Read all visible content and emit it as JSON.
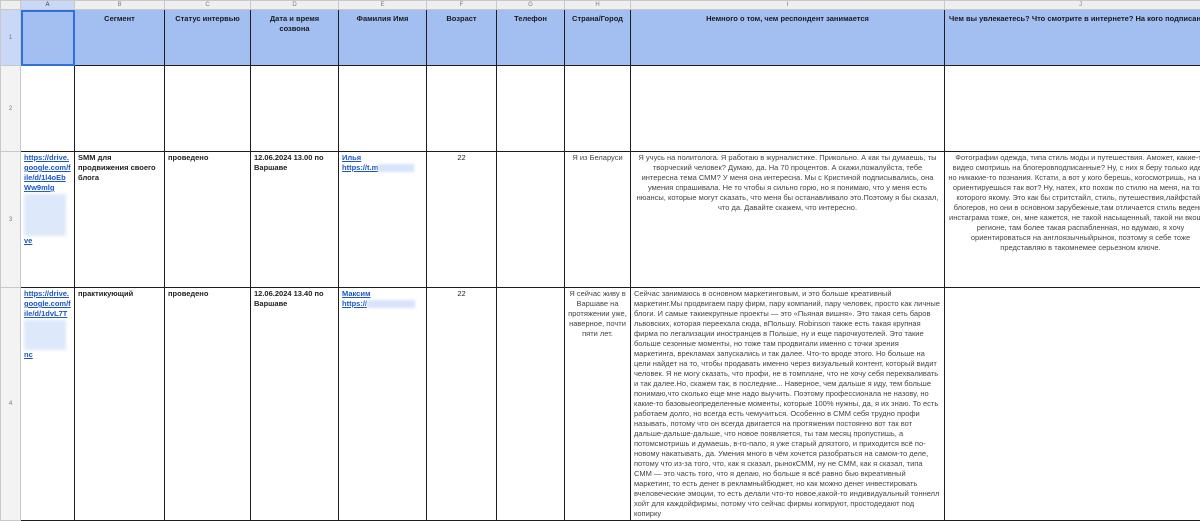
{
  "column_letters": [
    "A",
    "B",
    "C",
    "D",
    "E",
    "F",
    "G",
    "H",
    "I",
    "J"
  ],
  "row_numbers": [
    "1",
    "2",
    "3",
    "4"
  ],
  "headers": {
    "a": "",
    "b": "Сегмент",
    "c": "Статус интервью",
    "d": "Дата и время созвона",
    "e": "Фамилия Имя",
    "f": "Возраст",
    "g": "Телефон",
    "h": "Страна/Город",
    "i": "Немного о том, чем респондент занимается",
    "j": "Чем вы увлекаетесь? Что смотрите в интернете? На кого подписаны?"
  },
  "rows": [
    {
      "link": "https://drive.google.com/file/d/1l4oEb Ww9mlg",
      "link_tail": "ve",
      "segment": "SMM для продвижения своего блога",
      "status": "проведено",
      "datetime": "12.06.2024 13.00 по Варшаве",
      "name": "Илья",
      "contact_prefix": "https://t.m",
      "age": "22",
      "phone": "",
      "country": "Я из Беларуси",
      "about": "Я учусь на политолога. Я работаю в журналистике. Прикольно. А как ты думаешь, ты творческий человек? Думаю, да. На 70 процентов. А скажи,пожалуйста, тебе интересна тема СММ? У меня она интересна. Мы с Кристиной подписывались, она умения спрашивала. Не то чтобы я сильно горю, но я понимаю, что у меня есть нюансы, которые могут сказать, что меня бы останавливало это.Поэтому я бы сказал, что да. Давайте скажем, что интересно.",
      "hobbies": "Фотографии одежда, типа стиль моды и путешествия. Аможет, какие-то видео смотришь на блогеровподписанные? Ну, с них я беру только идеи, но никакие-то познания. Кстати, а вот у кого берешь, когосмотришь, на кого ориентируешься так вот? Ну, натех, кто похож по стилю на меня, на того, которого якому. Это как бы стритстайл, стиль, путешествия,лайфстайл блогеров, но они в основном зарубежные,там отличается стиль ведения инстаграма тоже, он, мне кажется, не такой насыщенный, такой ни вкошем регионе, там более такая распабленная, но вдумаю, я хочу ориентироваться на англоязычныйрынок, поэтому я себе тоже представляю в такомнемее серьезном ключе."
    },
    {
      "link": "https://drive.google.com/file/d/1dvL7T",
      "link_tail": "nc",
      "segment": "практикующий",
      "status": "проведено",
      "datetime": "12.06.2024 13.40 по Варшаве",
      "name": "Максим",
      "contact_prefix": "https://",
      "age": "22",
      "phone": "",
      "country": "Я сейчас живу в Варшаве на протяжении уже, наверное, почти пяти лет.",
      "about": "Сейчас занимаюсь в основном маркетинговым, и это больше креативный маркетинг.Мы продвигаем пару фирм, пару компаний, пару человек, просто как личные блоги. И самые такиекрупные проекты — это «Пьяная вишня». Это такая сеть баров львовских, которая переехала сюда, вПольшу. Robinson также есть такая крупная фирма по легализации иностранцев в Польше, ну и еще парочкуотелей. Это такие больше сезонные моменты, но тоже там продвигали именно с точки зрения маркетинга, врекламах запускались и так далее. Что-то вроде этого. Но больше на цели найдет на то, чтобы продавать именно через визуальный контент, который видит человек. Я не могу сказать, что профи, не в томплане, что не хочу себя перехваливать и так далее.Но, скажем так, в последние... Наверное, чем дальше я иду, тем больше понимаю,что сколько еще мне надо выучить. Поэтому профессионала не назову, но какие-то базовыеопределенные моменты, которые 100% нужны, да, я их знаю. То есть работаем долго, но всегда есть чемучиться. Особенно в СММ себя трудно профи называть, потому что он всегда двигается на протяжении постоянно вот так вот дальше-дальше-дальше, что новое появляется, ты там месяц пропустишь, а потомсмотришь и думаешь, в-го-пало, я уже старый дпязтого, и приходится всё по-новому накатывать, да. Умения много в чём хочется разобраться на самом-то деле, потому что из-за того, что, как я сказал, рынокСММ, ну не СММ, как я сказал, типа СММ — это часть того, что я делаю, но больше я всё равно бью вкреативный маркетинг, то есть денег в рекламныйбюджет, но как можно денег инвестировать вчеловеческие эмоции, то есть делали что-то новое,какой-то индивидуальный тоннелл хойт для каждойфирмы, потому что сейчас фирмы копируют, простодедают под копирку",
      "hobbies": ""
    }
  ]
}
